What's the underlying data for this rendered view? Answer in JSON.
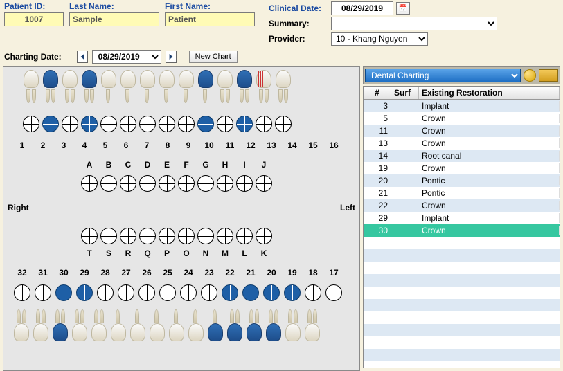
{
  "labels": {
    "patient_id": "Patient ID:",
    "last_name": "Last Name:",
    "first_name": "First Name:",
    "clinical_date": "Clinical Date:",
    "summary": "Summary:",
    "provider": "Provider:",
    "charting_date": "Charting Date:",
    "new_chart": "New Chart"
  },
  "patient": {
    "id": "1007",
    "last_name": "Sample",
    "first_name": "Patient"
  },
  "clinical_date": "08/29/2019",
  "summary": "",
  "provider": "10 - Khang Nguyen",
  "charting_date": "08/29/2019",
  "chart_mode": "Dental Charting",
  "upper_numbers": [
    "1",
    "2",
    "3",
    "4",
    "5",
    "6",
    "7",
    "8",
    "9",
    "10",
    "11",
    "12",
    "13",
    "14",
    "15",
    "16"
  ],
  "upper_letters": [
    "A",
    "B",
    "C",
    "D",
    "E",
    "F",
    "G",
    "H",
    "I",
    "J"
  ],
  "lower_numbers": [
    "32",
    "31",
    "30",
    "29",
    "28",
    "27",
    "26",
    "25",
    "24",
    "23",
    "22",
    "21",
    "20",
    "19",
    "18",
    "17"
  ],
  "lower_letters": [
    "T",
    "S",
    "R",
    "Q",
    "P",
    "O",
    "N",
    "M",
    "L",
    "K"
  ],
  "side_right": "Right",
  "side_left": "Left",
  "marked_upper": [
    3,
    5,
    11,
    13
  ],
  "rootcanal_upper": [
    14
  ],
  "marked_lower_circles": [
    30,
    29,
    22,
    21,
    20,
    19
  ],
  "marked_lower_teeth": [
    30,
    22,
    21,
    20,
    19
  ],
  "table": {
    "headers": {
      "num": "#",
      "surf": "Surf",
      "restoration": "Existing Restoration"
    },
    "rows": [
      {
        "num": "3",
        "surf": "",
        "restoration": "Implant"
      },
      {
        "num": "5",
        "surf": "",
        "restoration": "Crown"
      },
      {
        "num": "11",
        "surf": "",
        "restoration": "Crown"
      },
      {
        "num": "13",
        "surf": "",
        "restoration": "Crown"
      },
      {
        "num": "14",
        "surf": "",
        "restoration": "Root canal"
      },
      {
        "num": "19",
        "surf": "",
        "restoration": "Crown"
      },
      {
        "num": "20",
        "surf": "",
        "restoration": "Pontic"
      },
      {
        "num": "21",
        "surf": "",
        "restoration": "Pontic"
      },
      {
        "num": "22",
        "surf": "",
        "restoration": "Crown"
      },
      {
        "num": "29",
        "surf": "",
        "restoration": "Implant"
      },
      {
        "num": "30",
        "surf": "",
        "restoration": "Crown",
        "selected": true
      }
    ]
  }
}
